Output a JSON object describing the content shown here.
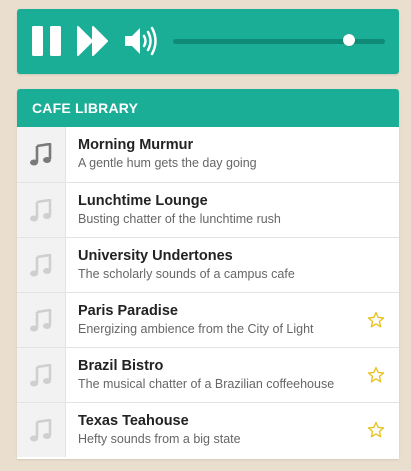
{
  "player": {
    "volume_level": 0.83,
    "accent_color": "#1aae97"
  },
  "library": {
    "title": "CAFE LIBRARY",
    "tracks": [
      {
        "title": "Morning Murmur",
        "description": "A gentle hum gets the day going",
        "icon": "music-note-icon",
        "active": true,
        "starred": false
      },
      {
        "title": "Lunchtime Lounge",
        "description": "Busting chatter of the lunchtime rush",
        "icon": "music-note-icon",
        "active": false,
        "starred": false
      },
      {
        "title": "University Undertones",
        "description": "The scholarly sounds of a campus cafe",
        "icon": "music-note-icon",
        "active": false,
        "starred": false
      },
      {
        "title": "Paris Paradise",
        "description": "Energizing ambience from the City of Light",
        "icon": "music-note-icon",
        "active": false,
        "starred": true
      },
      {
        "title": "Brazil Bistro",
        "description": "The musical chatter of a Brazilian coffeehouse",
        "icon": "music-note-icon",
        "active": false,
        "starred": true
      },
      {
        "title": "Texas Teahouse",
        "description": "Hefty sounds from a big state",
        "icon": "music-note-icon",
        "active": false,
        "starred": true
      }
    ]
  }
}
